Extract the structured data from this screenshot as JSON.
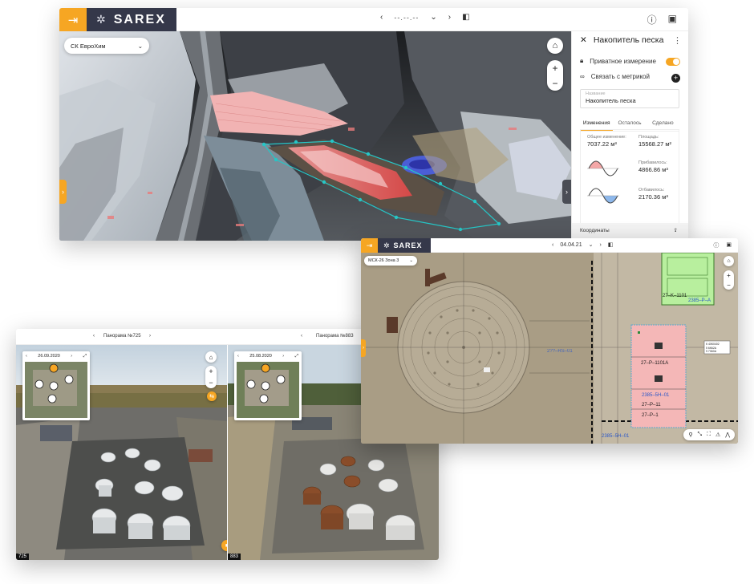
{
  "win1": {
    "brand": "SAREX",
    "date_value": "--.--.--",
    "site_select": "СК ЕвроХим",
    "panel": {
      "title": "Накопитель песка",
      "private_label": "Приватное измерение",
      "link_label": "Связать с метрикой",
      "name_label": "Название",
      "name_value": "Накопитель песка",
      "tabs": [
        "Изменения",
        "Осталось",
        "Сделано"
      ],
      "total_change_label": "Общее изменение:",
      "total_change_value": "7037.22 м³",
      "area_label": "Площадь:",
      "area_value": "15568.27 м²",
      "added_label": "Прибавилось:",
      "added_value": "4866.86 м³",
      "removed_label": "Отбавилось:",
      "removed_value": "2170.36 м³",
      "coords_label": "Координаты"
    }
  },
  "win2": {
    "left": {
      "title": "Панорама №725",
      "date": "26.09.2020",
      "number": "725"
    },
    "right": {
      "title": "Панорама №883",
      "date": "25.08.2020",
      "number": "883"
    }
  },
  "win3": {
    "brand": "SAREX",
    "date_value": "04.04.21",
    "crs_select": "МСК-26 Зона 3",
    "labels": {
      "tank_k": "27–K–1101",
      "code_top": "2385–P–А",
      "block_a": "27–P–1101A",
      "block_code": "2385–5H–01",
      "block_b": "27–P–11",
      "block_c": "27–P–1",
      "circle_label": "2??–RS–01",
      "bottom_label": "2385–5H–01",
      "tip1": "К 40К0402",
      "tip2": "5 6К62А",
      "tip3": "9 7060А"
    }
  }
}
